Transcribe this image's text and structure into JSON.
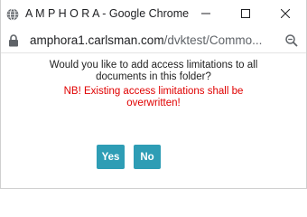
{
  "window": {
    "title": "A M P H O R A - Google Chrome"
  },
  "address": {
    "url_host": "amphora1.carlsman.com",
    "url_path": "/dvktest/Commo..."
  },
  "dialog": {
    "message_lines": [
      "Would you like to add access limitations to all",
      "documents in this folder?"
    ],
    "warning_lines": [
      "NB! Existing access limitations shall be",
      "overwritten!"
    ],
    "yes_label": "Yes",
    "no_label": "No"
  },
  "colors": {
    "button": "#2e9db5",
    "warning": "#e00000"
  },
  "icons": {
    "app": "globe-icon",
    "minimize": "minimize-icon",
    "maximize": "maximize-icon",
    "close": "close-icon",
    "lock": "lock-icon",
    "zoom": "zoom-icon"
  }
}
